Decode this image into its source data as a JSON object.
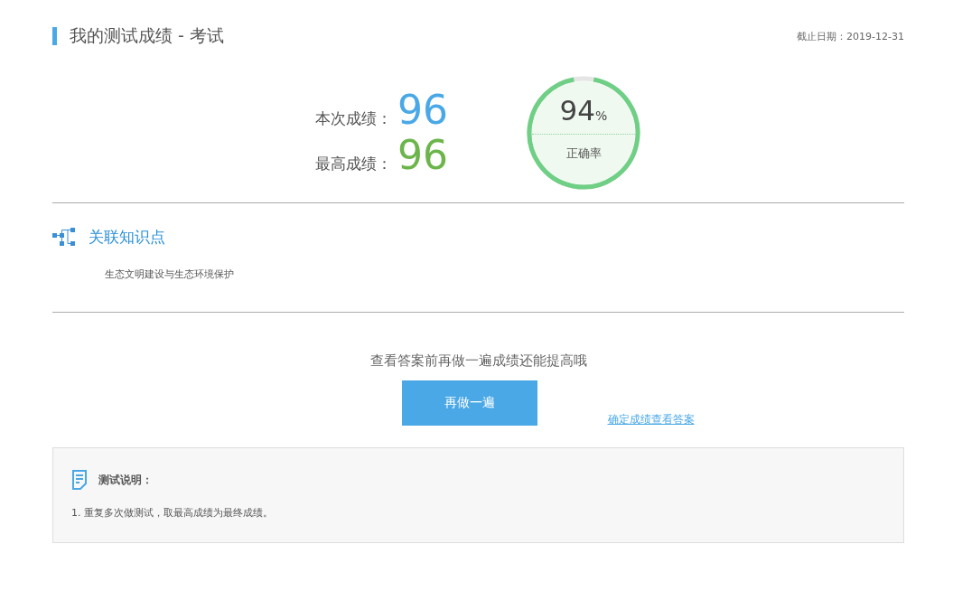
{
  "header": {
    "title": "我的测试成绩 - 考试",
    "deadline": "截止日期：2019-12-31"
  },
  "scores": [
    {
      "label": "本次成绩：",
      "value": "96",
      "color": "#4aa8e6"
    },
    {
      "label": "最高成绩：",
      "value": "96",
      "color": "#6bb54a"
    }
  ],
  "accuracy": {
    "value": "94",
    "unit": "%",
    "label": "正确率",
    "level": 0.94
  },
  "knowledge": {
    "title": "关联知识点",
    "items": [
      "生态文明建设与生态环境保护"
    ]
  },
  "retry": {
    "hint": "查看答案前再做一遍成绩还能提高哦",
    "button": "再做一遍",
    "link": "确定成绩查看答案"
  },
  "notes": {
    "title": "测试说明：",
    "items": [
      "1. 重复多次做测试，取最高成绩为最终成绩。"
    ]
  }
}
